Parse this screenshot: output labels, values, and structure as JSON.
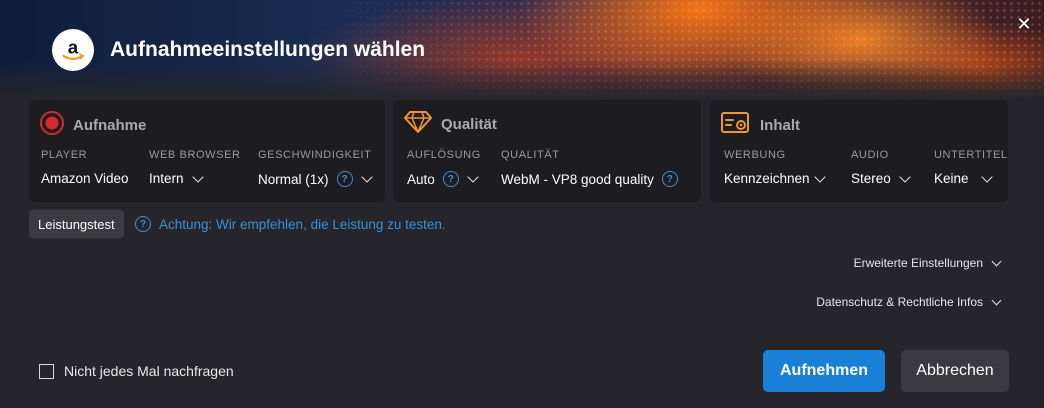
{
  "dialog": {
    "title": "Aufnahmeeinstellungen wählen",
    "close_glyph": "✕"
  },
  "cards": {
    "recording": {
      "title": "Aufnahme",
      "icon": "record-icon",
      "columns": [
        {
          "label": "PLAYER",
          "value": "Amazon Video"
        },
        {
          "label": "WEB BROWSER",
          "value": "Intern"
        },
        {
          "label": "GESCHWINDIGKEIT",
          "value": "Normal (1x)"
        }
      ]
    },
    "quality": {
      "title": "Qualität",
      "icon": "diamond-icon",
      "columns": [
        {
          "label": "AUFLÖSUNG",
          "value": "Auto"
        },
        {
          "label": "QUALITÄT",
          "value": "WebM - VP8 good quality"
        }
      ]
    },
    "content": {
      "title": "Inhalt",
      "icon": "content-settings-icon",
      "columns": [
        {
          "label": "WERBUNG",
          "value": "Kennzeichnen"
        },
        {
          "label": "AUDIO",
          "value": "Stereo"
        },
        {
          "label": "UNTERTITEL",
          "value": "Keine"
        }
      ]
    }
  },
  "performance": {
    "button_label": "Leistungstest",
    "note": "Achtung: Wir empfehlen, die Leistung zu testen."
  },
  "expanders": {
    "advanced": "Erweiterte Einstellungen",
    "privacy": "Datenschutz & Rechtliche Infos"
  },
  "footer": {
    "dont_ask_label": "Nicht jedes Mal nachfragen",
    "dont_ask_checked": false,
    "record_button": "Aufnehmen",
    "cancel_button": "Abbrechen"
  },
  "colors": {
    "accent_blue": "#1a7fd6",
    "record_red": "#d62a2a",
    "orange_icon": "#f0962e",
    "background": "#25252b",
    "card": "#1c1c21"
  }
}
